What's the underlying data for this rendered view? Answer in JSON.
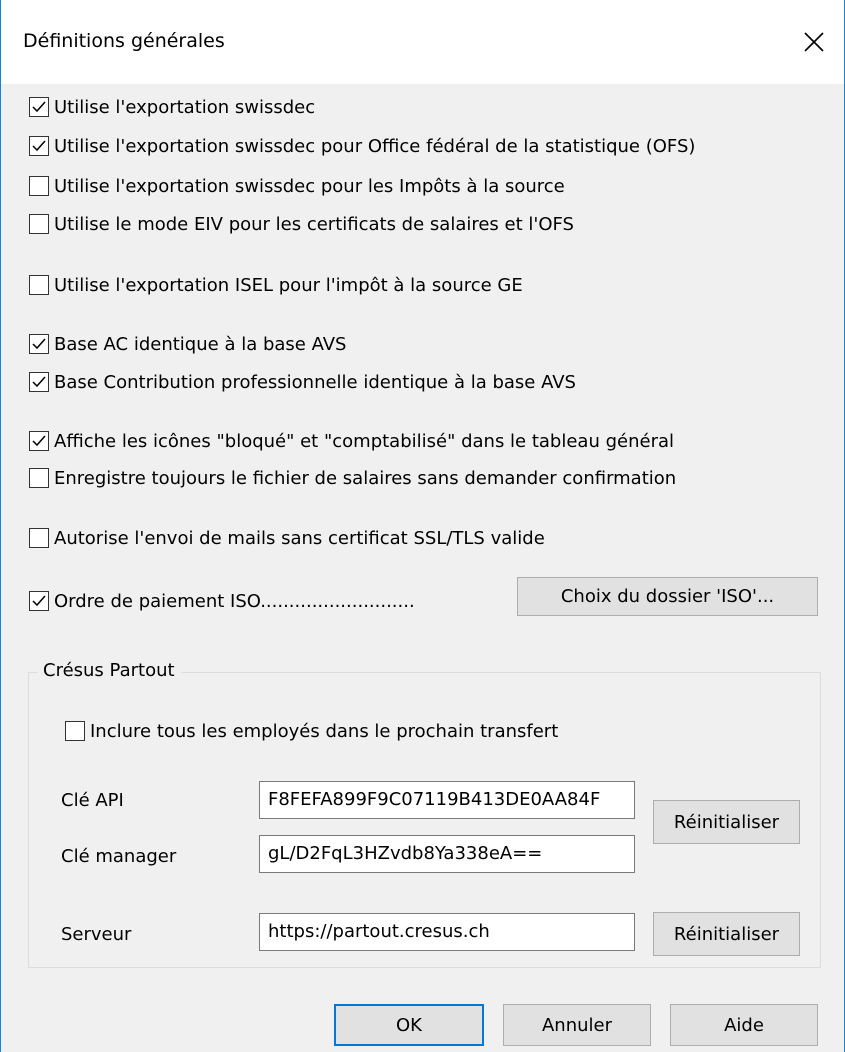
{
  "dialog": {
    "title": "Définitions générales"
  },
  "options": [
    {
      "label": "Utilise l'exportation swissdec",
      "checked": true
    },
    {
      "label": "Utilise l'exportation swissdec pour Office fédéral de la statistique (OFS)",
      "checked": true
    },
    {
      "label": "Utilise l'exportation swissdec pour les Impôts à la source",
      "checked": false
    },
    {
      "label": "Utilise le mode EIV pour les certificats de salaires et l'OFS",
      "checked": false
    },
    {
      "label": "Utilise l'exportation ISEL pour l'impôt à la source GE",
      "checked": false
    },
    {
      "label": "Base AC identique à la base AVS",
      "checked": true
    },
    {
      "label": "Base Contribution professionnelle identique à la base AVS",
      "checked": true
    },
    {
      "label": "Affiche les icônes \"bloqué\" et \"comptabilisé\" dans le tableau général",
      "checked": true
    },
    {
      "label": "Enregistre toujours le fichier de salaires sans demander confirmation",
      "checked": false
    },
    {
      "label": "Autorise l'envoi de mails sans certificat SSL/TLS valide",
      "checked": false
    },
    {
      "label": "Ordre de paiement ISO...........................",
      "checked": true
    }
  ],
  "iso_button": "Choix du dossier 'ISO'...",
  "partout": {
    "group_title": "Crésus Partout",
    "include_all": {
      "label": "Inclure tous les employés dans le prochain transfert",
      "checked": false
    },
    "api_key_label": "Clé API",
    "api_key_value": "F8FEFA899F9C07119B413DE0AA84F",
    "manager_key_label": "Clé manager",
    "manager_key_value": "gL/D2FqL3HZvdb8Ya338eA==",
    "reset_keys_button": "Réinitialiser",
    "server_label": "Serveur",
    "server_value": "https://partout.cresus.ch",
    "reset_server_button": "Réinitialiser"
  },
  "footer": {
    "ok": "OK",
    "cancel": "Annuler",
    "help": "Aide"
  }
}
